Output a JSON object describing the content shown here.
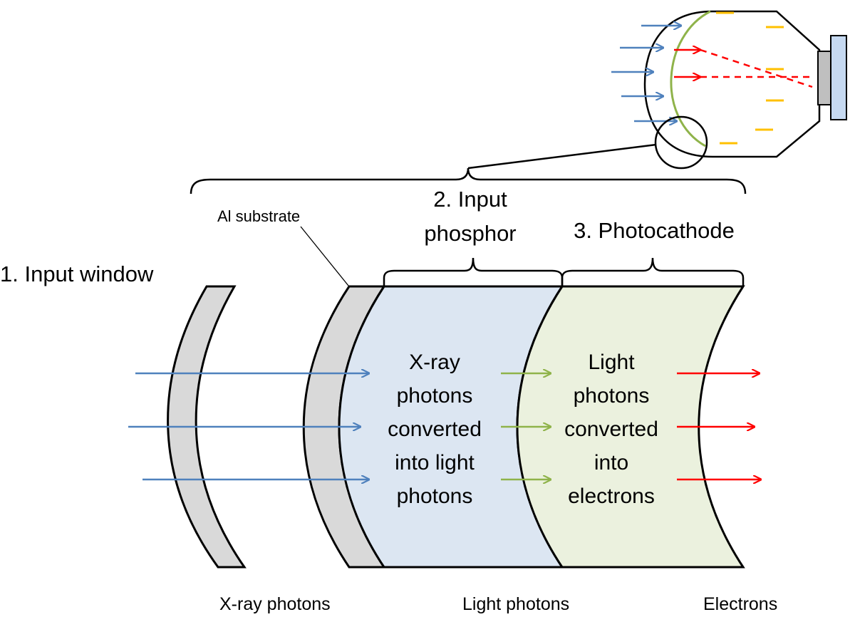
{
  "labels": {
    "input_window": "1. Input window",
    "al_substrate": "Al substrate",
    "input_phosphor_line1": "2. Input",
    "input_phosphor_line2": "phosphor",
    "photocathode": "3. Photocathode"
  },
  "phosphor_text": [
    "X-ray",
    "photons",
    "converted",
    "into light",
    "photons"
  ],
  "photocathode_text": [
    "Light",
    "photons",
    "converted",
    "into",
    "electrons"
  ],
  "bottom_labels": {
    "xray": "X-ray photons",
    "light": "Light photons",
    "electrons": "Electrons"
  },
  "colors": {
    "xray_arrow": "#4f81bd",
    "light_arrow": "#8fb34a",
    "electron_arrow": "#ff0000",
    "window_fill": "#d9d9d9",
    "phosphor_fill": "#dce6f2",
    "photocathode_fill": "#ebf1de",
    "phosphor_curve": "#8fb34a",
    "electrode": "#ffc000",
    "output_screen": "#c6d9f1",
    "output_housing": "#bfbfbf"
  }
}
